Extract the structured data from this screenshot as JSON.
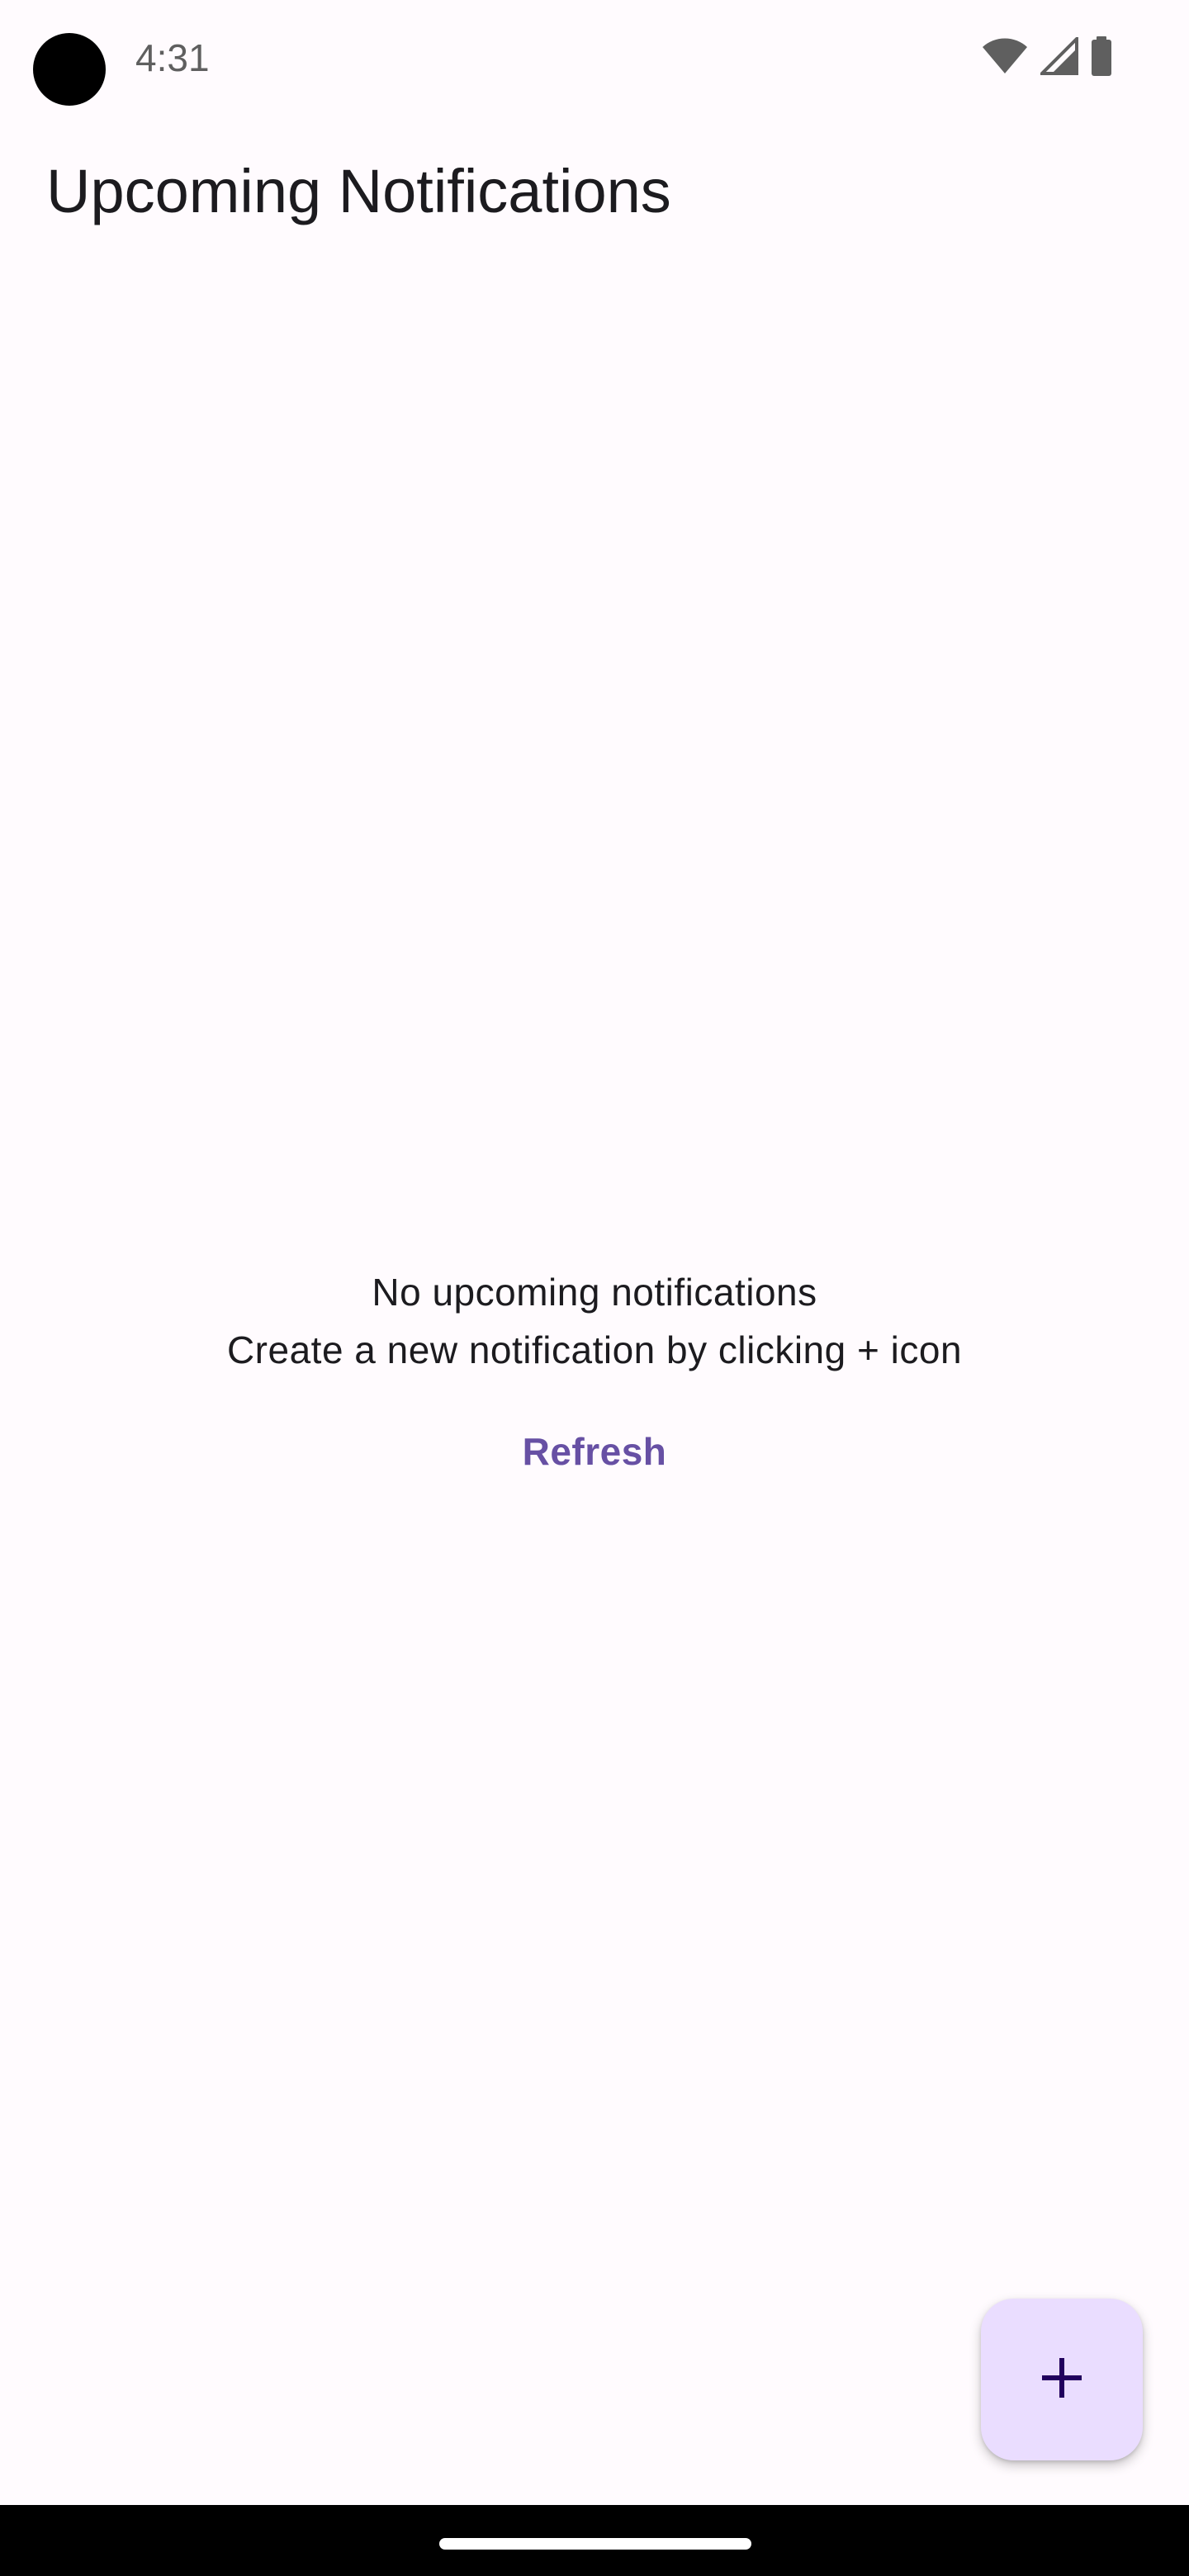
{
  "status_bar": {
    "time": "4:31",
    "icons": [
      "wifi-icon",
      "cell-signal-icon",
      "battery-icon"
    ]
  },
  "app_bar": {
    "title": "Upcoming Notifications"
  },
  "empty_state": {
    "heading": "No upcoming notifications",
    "hint": "Create a new notification by clicking + icon",
    "refresh_label": "Refresh"
  },
  "fab": {
    "icon": "plus-icon"
  },
  "colors": {
    "background": "#fffbfe",
    "accent": "#6750a4",
    "fab_container": "#eaddff",
    "fab_icon": "#21005d",
    "text": "#1c1b1f"
  }
}
